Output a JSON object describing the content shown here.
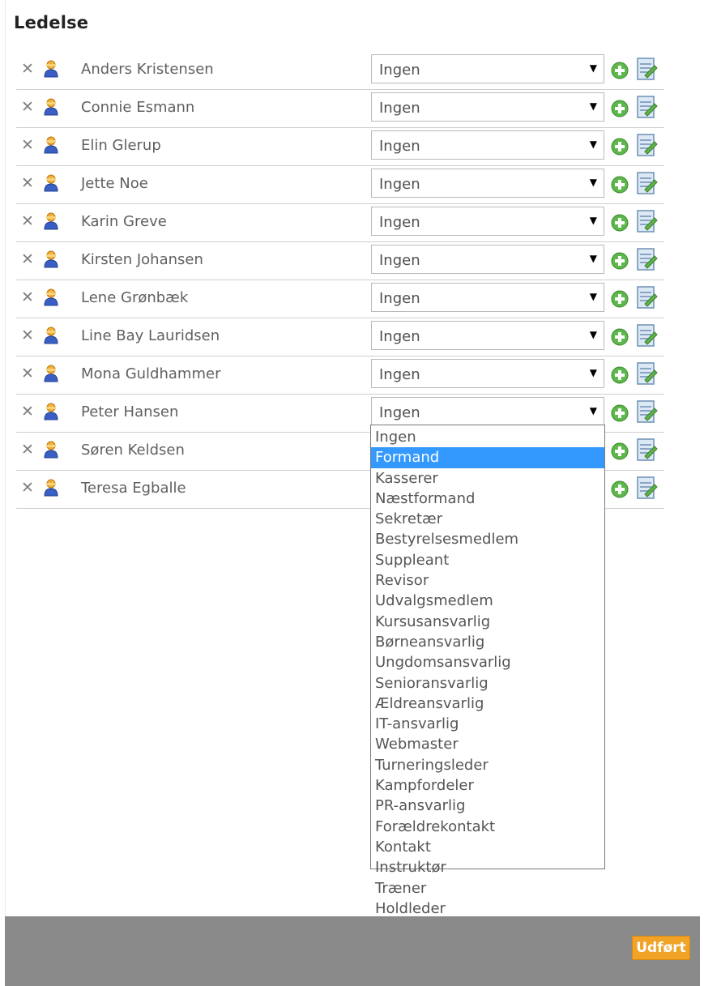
{
  "section": {
    "title": "Ledelse"
  },
  "members": [
    {
      "name": "Anders Kristensen",
      "role": "Ingen"
    },
    {
      "name": "Connie Esmann",
      "role": "Ingen"
    },
    {
      "name": "Elin Glerup",
      "role": "Ingen"
    },
    {
      "name": "Jette Noe",
      "role": "Ingen"
    },
    {
      "name": "Karin Greve",
      "role": "Ingen"
    },
    {
      "name": "Kirsten Johansen",
      "role": "Ingen"
    },
    {
      "name": "Lene Grønbæk",
      "role": "Ingen"
    },
    {
      "name": "Line Bay Lauridsen",
      "role": "Ingen"
    },
    {
      "name": "Mona Guldhammer",
      "role": "Ingen"
    },
    {
      "name": "Peter Hansen",
      "role": "Ingen"
    },
    {
      "name": "Søren Keldsen",
      "role": ""
    },
    {
      "name": "Teresa Egballe",
      "role": ""
    }
  ],
  "role_options": [
    "Ingen",
    "Formand",
    "Kasserer",
    "Næstformand",
    "Sekretær",
    "Bestyrelsesmedlem",
    "Suppleant",
    "Revisor",
    "Udvalgsmedlem",
    "Kursusansvarlig",
    "Børneansvarlig",
    "Ungdomsansvarlig",
    "Senioransvarlig",
    "Ældreansvarlig",
    "IT-ansvarlig",
    "Webmaster",
    "Turneringsleder",
    "Kampfordeler",
    "PR-ansvarlig",
    "Forældrekontakt",
    "Kontakt",
    "Instruktør",
    "Træner",
    "Holdleder"
  ],
  "dropdown": {
    "open_row": 9,
    "highlighted": "Formand"
  },
  "icons": {
    "remove": "close-icon",
    "user": "user-icon",
    "add": "plus-circle-icon",
    "edit": "edit-document-icon"
  },
  "colors": {
    "accent": "#f0a326",
    "highlight": "#3399ff",
    "footer": "#8a8a8a"
  },
  "footer": {
    "done_label": "Udført"
  }
}
